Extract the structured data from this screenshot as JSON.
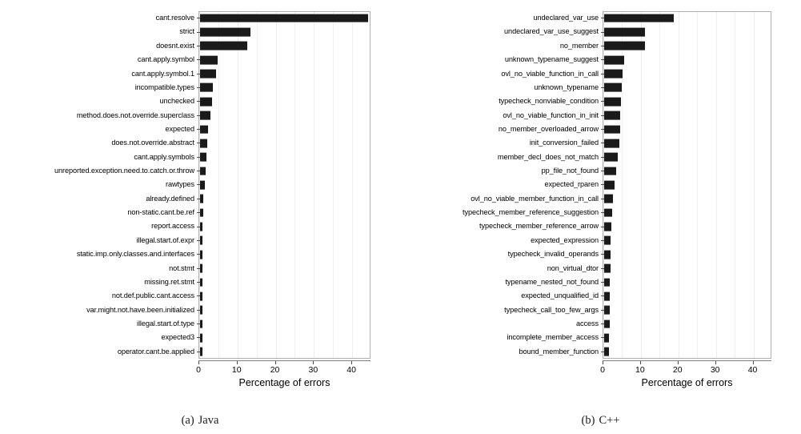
{
  "figure": {
    "panels": [
      {
        "id": "java",
        "caption_label": "(a)",
        "caption_text": "Java",
        "axis_title": "Percentage of errors",
        "xticks": [
          "0",
          "10",
          "20",
          "30",
          "40"
        ]
      },
      {
        "id": "cpp",
        "caption_label": "(b)",
        "caption_text": "C++",
        "axis_title": "Percentage of errors",
        "xticks": [
          "0",
          "10",
          "20",
          "30",
          "40"
        ]
      }
    ]
  },
  "chart_data": [
    {
      "type": "bar",
      "orientation": "horizontal",
      "title": "(a) Java",
      "xlabel": "Percentage of errors",
      "ylabel": "",
      "xlim": [
        0,
        45
      ],
      "xticks": [
        0,
        10,
        20,
        30,
        40
      ],
      "grid": true,
      "legend": "none",
      "categories": [
        "cant.resolve",
        "strict",
        "doesnt.exist",
        "cant.apply.symbol",
        "cant.apply.symbol.1",
        "incompatible.types",
        "unchecked",
        "method.does.not.override.superclass",
        "expected",
        "does.not.override.abstract",
        "cant.apply.symbols",
        "unreported.exception.need.to.catch.or.throw",
        "rawtypes",
        "already.defined",
        "non-static.cant.be.ref",
        "report.access",
        "illegal.start.of.expr",
        "static.imp.only.classes.and.interfaces",
        "not.stmt",
        "missing.ret.stmt",
        "not.def.public.cant.access",
        "var.might.not.have.been.initialized",
        "illegal.start.of.type",
        "expected3",
        "operator.cant.be.applied"
      ],
      "values": [
        44.0,
        13.2,
        12.3,
        4.6,
        4.2,
        3.4,
        3.1,
        2.8,
        2.1,
        1.9,
        1.6,
        1.4,
        1.2,
        0.9,
        0.8,
        0.7,
        0.65,
        0.6,
        0.55,
        0.5,
        0.45,
        0.4,
        0.38,
        0.35,
        0.3
      ]
    },
    {
      "type": "bar",
      "orientation": "horizontal",
      "title": "(b) C++",
      "xlabel": "Percentage of errors",
      "ylabel": "",
      "xlim": [
        0,
        45
      ],
      "xticks": [
        0,
        10,
        20,
        30,
        40
      ],
      "grid": true,
      "legend": "none",
      "categories": [
        "undeclared_var_use",
        "undeclared_var_use_suggest",
        "no_member",
        "unknown_typename_suggest",
        "ovl_no_viable_function_in_call",
        "unknown_typename",
        "typecheck_nonviable_condition",
        "ovl_no_viable_function_in_init",
        "no_member_overloaded_arrow",
        "init_conversion_failed",
        "member_decl_does_not_match",
        "pp_file_not_found",
        "expected_rparen",
        "ovl_no_viable_member_function_in_call",
        "typecheck_member_reference_suggestion",
        "typecheck_member_reference_arrow",
        "expected_expression",
        "typecheck_invalid_operands",
        "non_virtual_dtor",
        "typename_nested_not_found",
        "expected_unqualified_id",
        "typecheck_call_too_few_args",
        "access",
        "incomplete_member_access",
        "bound_member_function"
      ],
      "values": [
        18.5,
        10.9,
        10.8,
        5.4,
        4.8,
        4.6,
        4.4,
        4.3,
        4.2,
        4.0,
        3.6,
        3.1,
        2.8,
        2.4,
        2.2,
        2.0,
        1.8,
        1.7,
        1.6,
        1.55,
        1.5,
        1.45,
        1.4,
        1.35,
        1.3
      ]
    }
  ]
}
